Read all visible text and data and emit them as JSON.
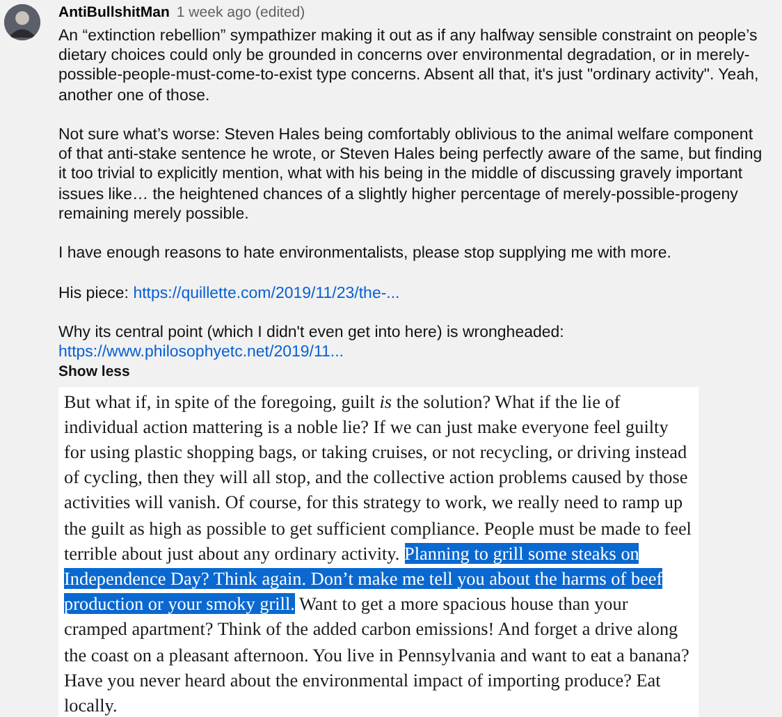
{
  "comment": {
    "author": "AntiBullshitMan",
    "time": "1 week ago (edited)",
    "paragraphs": [
      {
        "parts": [
          {
            "kind": "text",
            "text": "An “extinction rebellion” sympathizer making it out as if any halfway sensible constraint on people’s dietary choices could only be grounded in concerns over environmental degradation, or in merely-possible-people-must-come-to-exist type concerns. Absent all that, it's just \"ordinary activity\". Yeah, another one of those."
          }
        ]
      },
      {
        "parts": [
          {
            "kind": "text",
            "text": "Not sure what’s worse: Steven Hales being comfortably oblivious to the animal welfare component of that anti-stake sentence he wrote, or Steven Hales being perfectly aware of the same, but finding it too trivial to explicitly mention, what with his being in the middle of discussing gravely important issues like… the heightened chances of a slightly higher percentage of merely-possible-progeny remaining merely possible."
          }
        ]
      },
      {
        "parts": [
          {
            "kind": "text",
            "text": "I have enough reasons to hate environmentalists, please stop supplying me with more."
          }
        ]
      },
      {
        "parts": [
          {
            "kind": "text",
            "text": "His piece: "
          },
          {
            "kind": "link",
            "text": "https://quillette.com/2019/11/23/the-..."
          }
        ]
      },
      {
        "parts": [
          {
            "kind": "text",
            "text": "Why its central point (which I didn't even get into here) is wrongheaded:"
          },
          {
            "kind": "link",
            "text": "https://www.philosophyetc.net/2019/11..."
          }
        ]
      }
    ],
    "toggle": "Show less"
  },
  "excerpt": {
    "segments": [
      {
        "text": "But what if, in spite of the foregoing, guilt *is* the solution? What if the lie of individual action mattering is a noble lie? If we can just make everyone feel guilty for using plastic shopping bags, or taking cruises, or not recycling, or driving instead of cycling, then they will all stop, and the collective action problems caused by those activities will vanish. Of course, for this strategy to work, we really need to ramp up the guilt as high as possible to get sufficient compliance. People must be made to feel terrible about just about any ordinary activity. ",
        "selected": false
      },
      {
        "text": "Planning to grill some steaks on Independence Day? Think again. Don’t make me tell you about the harms of beef production or your smoky grill.",
        "selected": true
      },
      {
        "text": " Want to get a more spacious house than your cramped apartment? Think of the added carbon emissions! And forget a drive along the coast on a pleasant afternoon. You live in Pennsylvania and want to eat a banana? Have you never heard about the environmental impact of importing produce? Eat locally.",
        "selected": false
      }
    ]
  }
}
